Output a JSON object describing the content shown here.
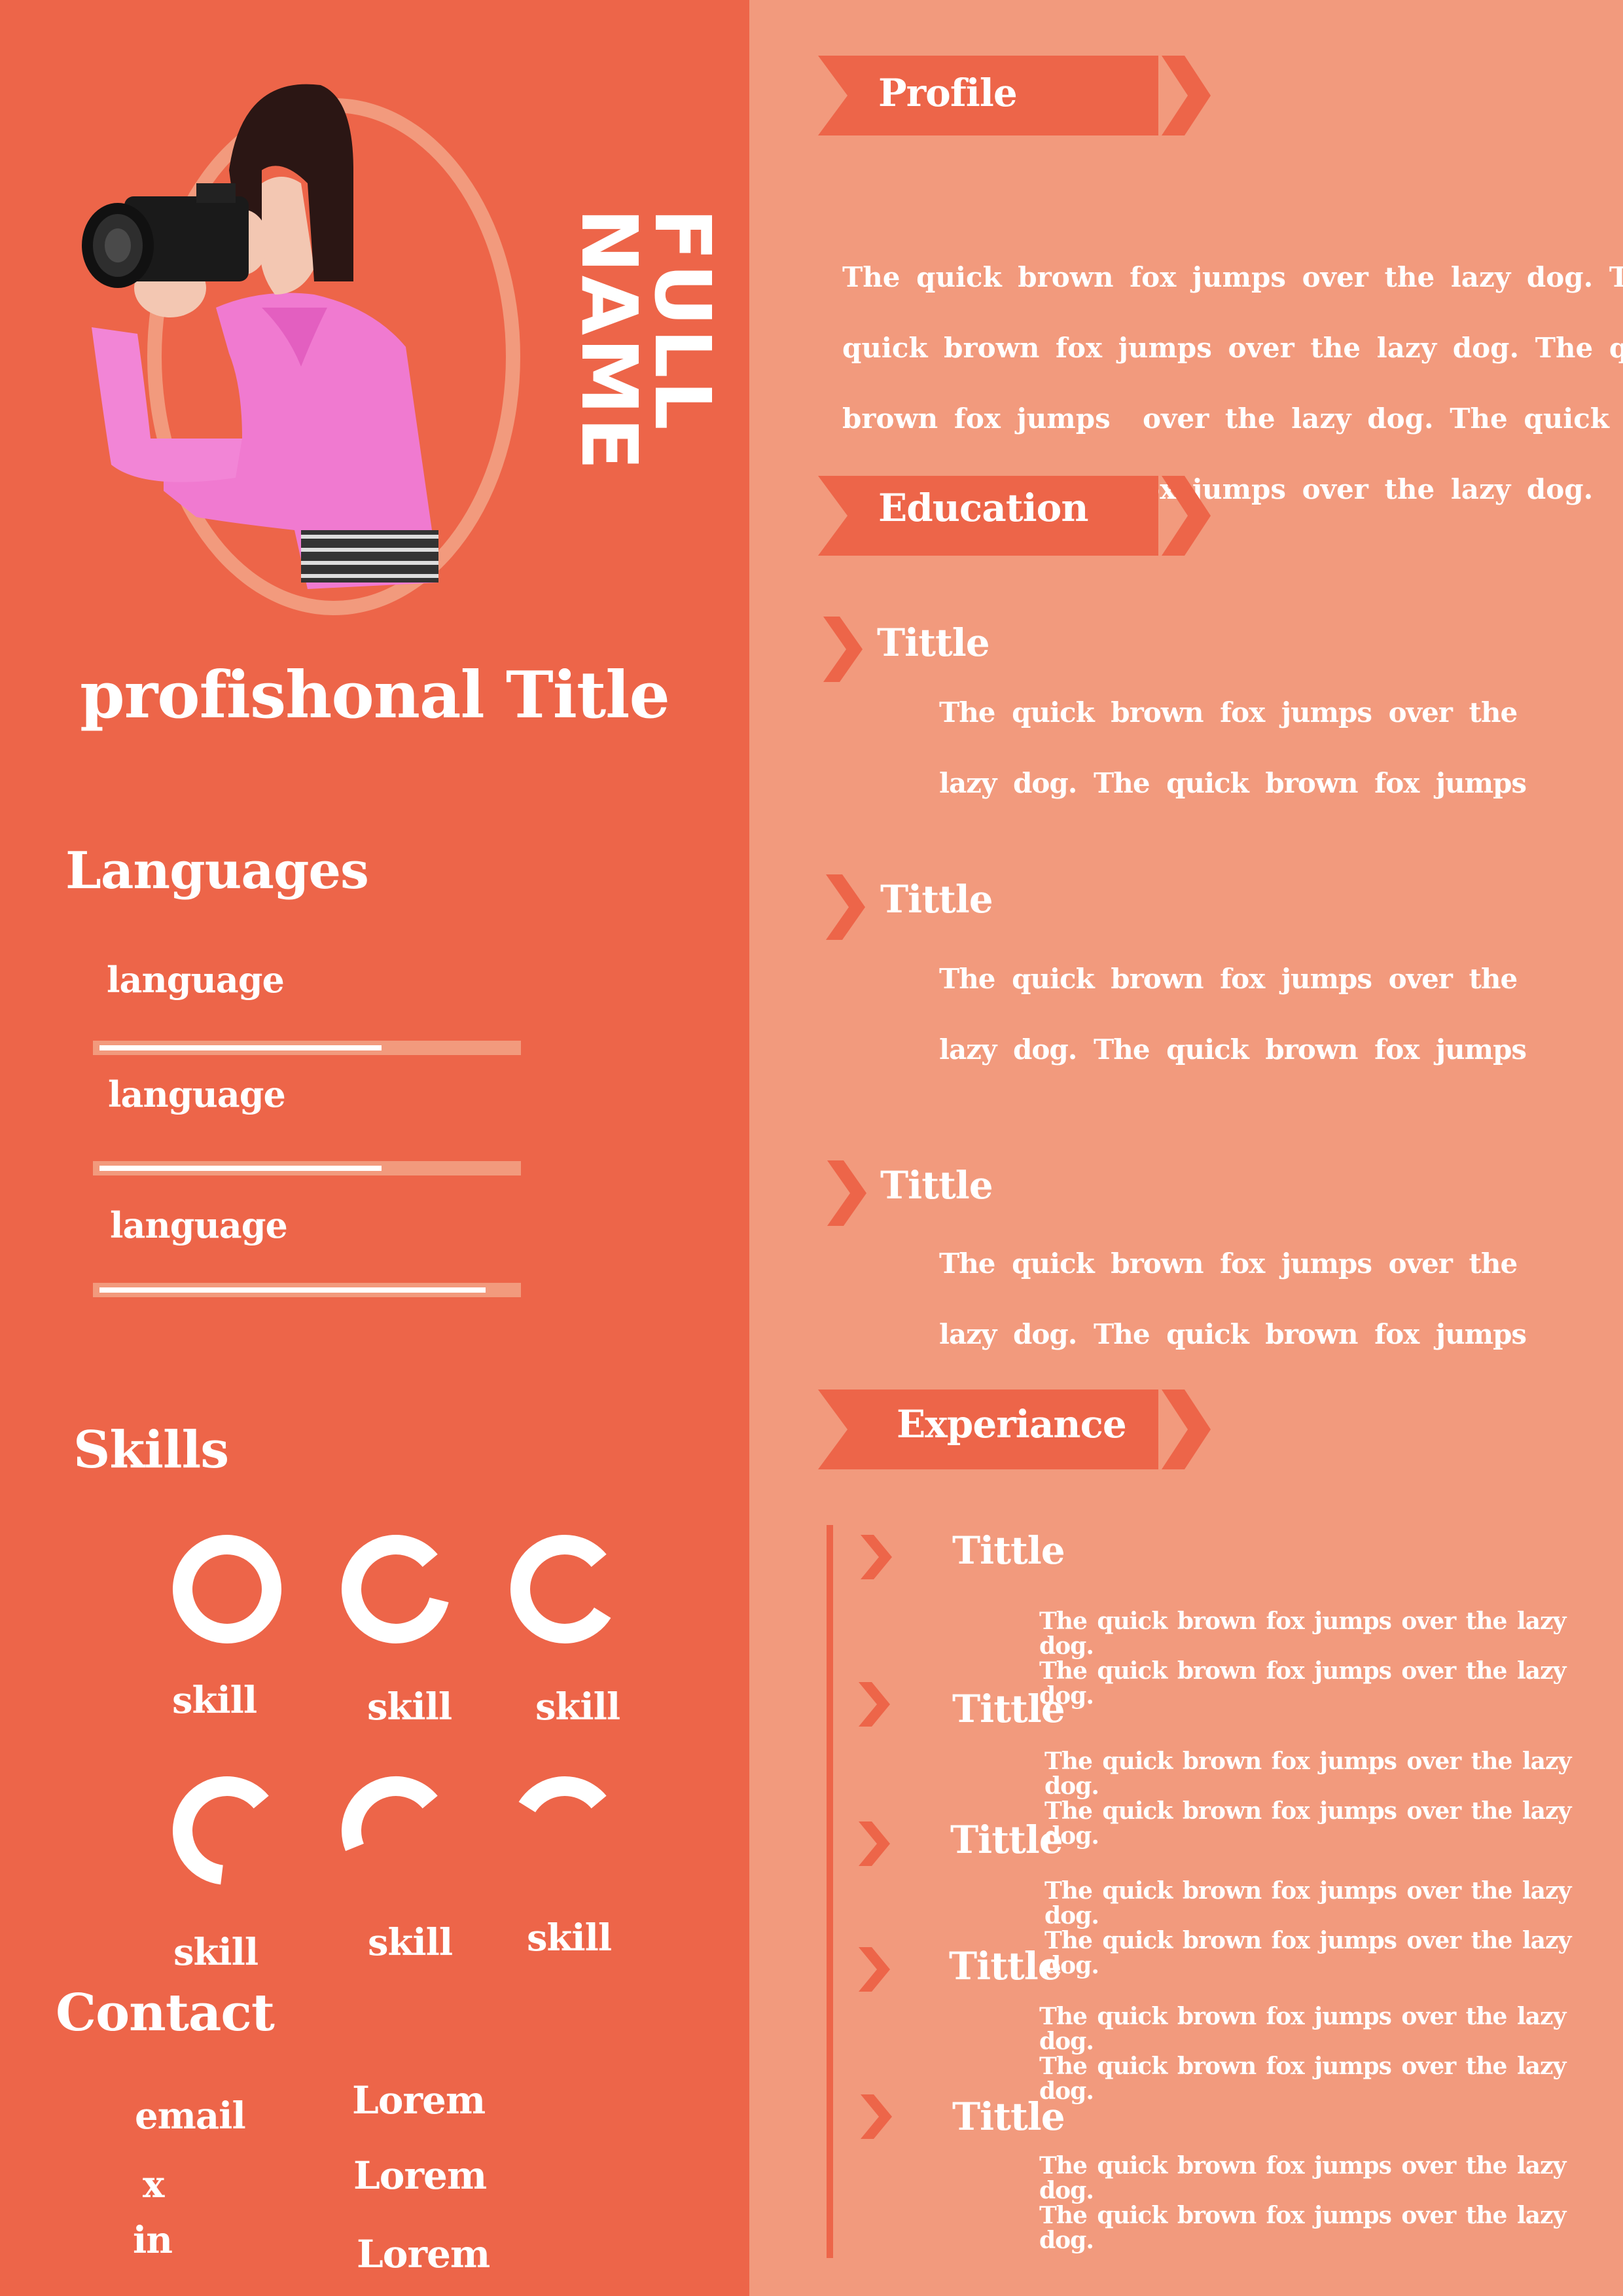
{
  "name": {
    "line1": "FULL",
    "line2": "NAME"
  },
  "professional_title": "profishonal  Title",
  "languages": {
    "heading": "Languages",
    "items": [
      {
        "label": "language",
        "level": 0.68
      },
      {
        "label": "language",
        "level": 0.68
      },
      {
        "label": "language",
        "level": 0.93
      }
    ]
  },
  "skills": {
    "heading": "Skills",
    "items": [
      {
        "label": "skill",
        "level": 1.0
      },
      {
        "label": "skill",
        "level": 0.85
      },
      {
        "label": "skill",
        "level": 0.8
      },
      {
        "label": "skill",
        "level": 0.62
      },
      {
        "label": "skill",
        "level": 0.45
      },
      {
        "label": "skill",
        "level": 0.3
      }
    ]
  },
  "contact": {
    "heading": "Contact",
    "items": [
      {
        "label": "email",
        "value": "Lorem"
      },
      {
        "label": "x",
        "value": "Lorem"
      },
      {
        "label": "in",
        "value": "Lorem"
      }
    ]
  },
  "profile": {
    "heading": "Profile",
    "lines": [
      "The quick brown fox jumps over the lazy dog. The",
      "quick brown fox jumps over the lazy dog. The quick",
      "brown fox jumps  over the lazy dog. The quick dog.",
      "The quick brown fox jumps over the lazy dog."
    ]
  },
  "education": {
    "heading": "Education",
    "items": [
      {
        "title": "Tittle",
        "line1": "The quick brown fox jumps over the",
        "line2": "lazy dog. The quick brown fox jumps"
      },
      {
        "title": "Tittle",
        "line1": "The quick brown fox jumps over the",
        "line2": "lazy dog. The quick brown fox jumps"
      },
      {
        "title": "Tittle",
        "line1": "The quick brown fox jumps over the",
        "line2": "lazy dog. The quick brown fox jumps"
      }
    ]
  },
  "experience": {
    "heading": "Experiance",
    "items": [
      {
        "title": "Tittle",
        "line1": "The quick brown fox jumps over the lazy dog.",
        "line2": "The quick brown fox jumps over the lazy dog."
      },
      {
        "title": "Tittle",
        "line1": "The quick brown fox jumps over the lazy dog.",
        "line2": "The quick brown fox jumps over the lazy dog."
      },
      {
        "title": "Tittle",
        "line1": "The quick brown fox jumps over the lazy dog.",
        "line2": "The quick brown fox jumps over the lazy dog."
      },
      {
        "title": "Tittle",
        "line1": "The quick brown fox jumps over the lazy dog.",
        "line2": "The quick brown fox jumps over the lazy dog."
      },
      {
        "title": "Tittle",
        "line1": "The quick brown fox jumps over the lazy dog.",
        "line2": "The quick brown fox jumps over the lazy dog."
      }
    ]
  },
  "colors": {
    "dark": "#ed6549",
    "light": "#f29a7d",
    "text": "#ffffff"
  }
}
